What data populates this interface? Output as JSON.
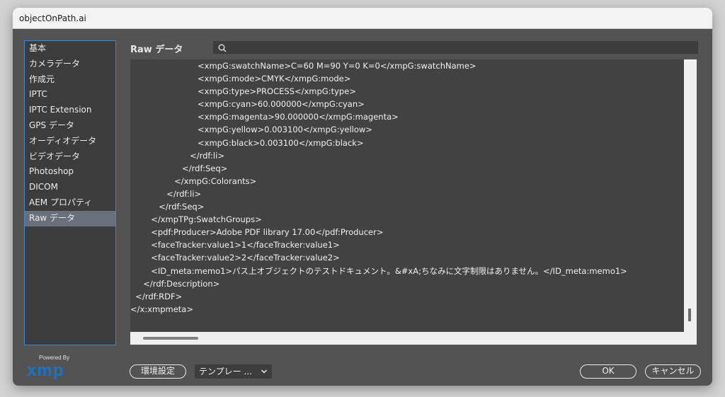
{
  "window": {
    "title": "objectOnPath.ai"
  },
  "sidebar": {
    "items": [
      {
        "label": "基本"
      },
      {
        "label": "カメラデータ"
      },
      {
        "label": "作成元"
      },
      {
        "label": "IPTC"
      },
      {
        "label": "IPTC Extension"
      },
      {
        "label": "GPS データ"
      },
      {
        "label": "オーディオデータ"
      },
      {
        "label": "ビデオデータ"
      },
      {
        "label": "Photoshop"
      },
      {
        "label": "DICOM"
      },
      {
        "label": "AEM プロパティ"
      },
      {
        "label": "Raw データ"
      }
    ],
    "selected_index": 11
  },
  "logo": {
    "powered_by": "Powered By",
    "mark": "xmp"
  },
  "panel": {
    "label": "Raw データ"
  },
  "search": {
    "placeholder": "",
    "value": ""
  },
  "raw_lines": [
    "                          <xmpG:swatchName>C=60 M=90 Y=0 K=0</xmpG:swatchName>",
    "                          <xmpG:mode>CMYK</xmpG:mode>",
    "                          <xmpG:type>PROCESS</xmpG:type>",
    "                          <xmpG:cyan>60.000000</xmpG:cyan>",
    "                          <xmpG:magenta>90.000000</xmpG:magenta>",
    "                          <xmpG:yellow>0.003100</xmpG:yellow>",
    "                          <xmpG:black>0.003100</xmpG:black>",
    "                       </rdf:li>",
    "                    </rdf:Seq>",
    "                 </xmpG:Colorants>",
    "              </rdf:li>",
    "           </rdf:Seq>",
    "        </xmpTPg:SwatchGroups>",
    "        <pdf:Producer>Adobe PDF library 17.00</pdf:Producer>",
    "        <faceTracker:value1>1</faceTracker:value1>",
    "        <faceTracker:value2>2</faceTracker:value2>",
    "        <ID_meta:memo1>パス上オブジェクトのテストドキュメント。&#xA;ちなみに文字制限はありません。</ID_meta:memo1>",
    "     </rdf:Description>",
    "  </rdf:RDF>",
    "</x:xmpmeta>"
  ],
  "buttons": {
    "preferences": "環境設定",
    "template": "テンプレー ...",
    "ok": "OK",
    "cancel": "キャンセル"
  },
  "colors": {
    "selection": "#69707b",
    "sidebar_border": "#4c84c4",
    "xmp_logo": "#1a73c9"
  }
}
